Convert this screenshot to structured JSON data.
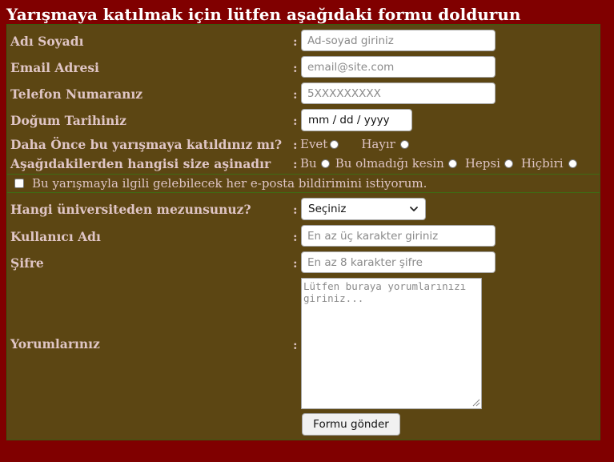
{
  "page": {
    "title": "Yarışmaya katılmak için lütfen aşağıdaki formu doldurun"
  },
  "form": {
    "colon": ":",
    "name": {
      "label": "Adı Soyadı",
      "placeholder": "Ad-soyad giriniz"
    },
    "email": {
      "label": "Email Adresi",
      "placeholder": "email@site.com"
    },
    "phone": {
      "label": "Telefon Numaranız",
      "placeholder": "5XXXXXXXXX"
    },
    "birthdate": {
      "label": "Doğum Tarihiniz",
      "value": "mm / dd / yyyy"
    },
    "participated": {
      "label": "Daha Önce bu yarışmaya katıldınız mı?",
      "options": [
        "Evet",
        "Hayır"
      ]
    },
    "familiar": {
      "label": "Aşağıdakilerden hangisi size aşinadır",
      "options": [
        "Bu",
        "Bu olmadığı kesin",
        "Hepsi",
        "Hiçbiri"
      ]
    },
    "notifications": {
      "label": "Bu yarışmayla ilgili gelebilecek her e-posta bildirimini istiyorum.",
      "checked": false
    },
    "university": {
      "label": "Hangi üniversiteden mezunsunuz?",
      "selected": "Seçiniz"
    },
    "username": {
      "label": "Kullanıcı Adı",
      "placeholder": "En az üç karakter giriniz"
    },
    "password": {
      "label": "Şifre",
      "placeholder": "En az 8 karakter şifre"
    },
    "comments": {
      "label": "Yorumlarınız",
      "placeholder": "Lütfen buraya yorumlarınızı giriniz..."
    },
    "submit_label": "Formu gönder"
  },
  "colors": {
    "page_background": "#800000",
    "panel_background": "#5c4613",
    "label_text": "#dfc5c5",
    "title_text": "#ffffff"
  },
  "icons": {
    "select": "chevron-down-icon",
    "textarea": "resize-grip-icon"
  }
}
